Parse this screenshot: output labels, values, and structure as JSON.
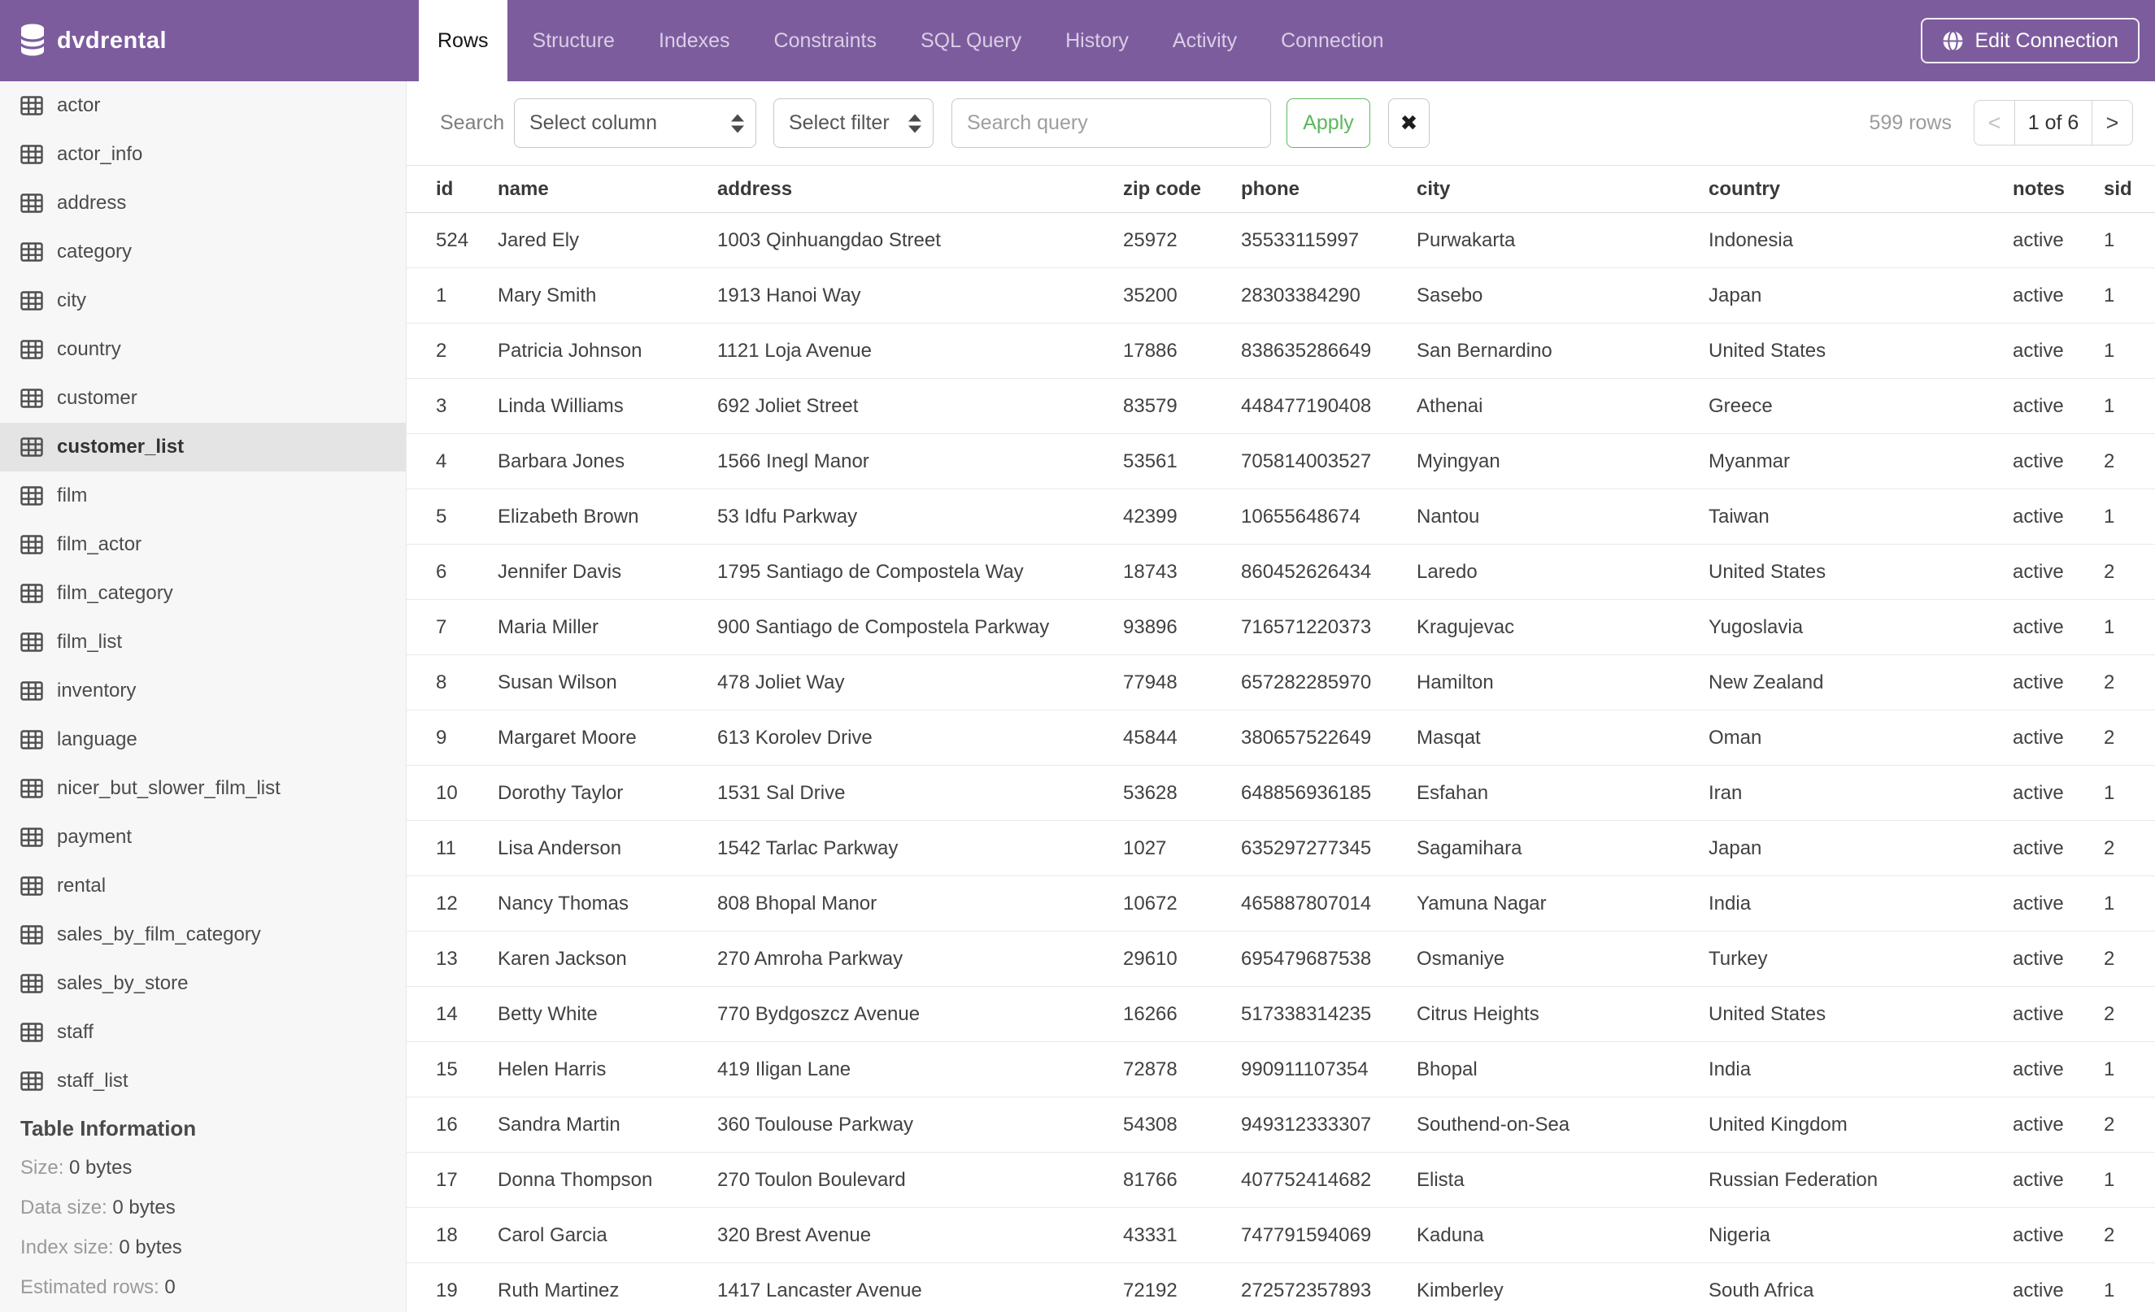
{
  "colors": {
    "purple": "#7D5C9E",
    "green": "#5CB85C",
    "sidebar_selected": "#E4E4E4"
  },
  "header": {
    "logo": "dvdrental",
    "tabs": [
      {
        "label": "Rows",
        "active": true
      },
      {
        "label": "Structure",
        "active": false
      },
      {
        "label": "Indexes",
        "active": false
      },
      {
        "label": "Constraints",
        "active": false
      },
      {
        "label": "SQL Query",
        "active": false
      },
      {
        "label": "History",
        "active": false
      },
      {
        "label": "Activity",
        "active": false
      },
      {
        "label": "Connection",
        "active": false
      }
    ],
    "edit_connection_label": "Edit Connection"
  },
  "sidebar": {
    "tables": [
      {
        "name": "actor",
        "selected": false
      },
      {
        "name": "actor_info",
        "selected": false
      },
      {
        "name": "address",
        "selected": false
      },
      {
        "name": "category",
        "selected": false
      },
      {
        "name": "city",
        "selected": false
      },
      {
        "name": "country",
        "selected": false
      },
      {
        "name": "customer",
        "selected": false
      },
      {
        "name": "customer_list",
        "selected": true
      },
      {
        "name": "film",
        "selected": false
      },
      {
        "name": "film_actor",
        "selected": false
      },
      {
        "name": "film_category",
        "selected": false
      },
      {
        "name": "film_list",
        "selected": false
      },
      {
        "name": "inventory",
        "selected": false
      },
      {
        "name": "language",
        "selected": false
      },
      {
        "name": "nicer_but_slower_film_list",
        "selected": false
      },
      {
        "name": "payment",
        "selected": false
      },
      {
        "name": "rental",
        "selected": false
      },
      {
        "name": "sales_by_film_category",
        "selected": false
      },
      {
        "name": "sales_by_store",
        "selected": false
      },
      {
        "name": "staff",
        "selected": false
      },
      {
        "name": "staff_list",
        "selected": false
      }
    ],
    "table_information": {
      "title": "Table Information",
      "rows": [
        {
          "label": "Size:",
          "value": "0 bytes"
        },
        {
          "label": "Data size:",
          "value": "0 bytes"
        },
        {
          "label": "Index size:",
          "value": "0 bytes"
        },
        {
          "label": "Estimated rows:",
          "value": "0"
        }
      ]
    }
  },
  "toolbar": {
    "search_label": "Search",
    "select_column_placeholder": "Select column",
    "select_filter_placeholder": "Select filter",
    "search_query_placeholder": "Search query",
    "apply_label": "Apply",
    "clear_label": "✖",
    "row_count": "599 rows",
    "pagination": {
      "prev": "<",
      "current": "1 of 6",
      "next": ">"
    }
  },
  "table": {
    "columns": [
      "id",
      "name",
      "address",
      "zip code",
      "phone",
      "city",
      "country",
      "notes",
      "sid"
    ],
    "rows": [
      [
        "524",
        "Jared Ely",
        "1003 Qinhuangdao Street",
        "25972",
        "35533115997",
        "Purwakarta",
        "Indonesia",
        "active",
        "1"
      ],
      [
        "1",
        "Mary Smith",
        "1913 Hanoi Way",
        "35200",
        "28303384290",
        "Sasebo",
        "Japan",
        "active",
        "1"
      ],
      [
        "2",
        "Patricia Johnson",
        "1121 Loja Avenue",
        "17886",
        "838635286649",
        "San Bernardino",
        "United States",
        "active",
        "1"
      ],
      [
        "3",
        "Linda Williams",
        "692 Joliet Street",
        "83579",
        "448477190408",
        "Athenai",
        "Greece",
        "active",
        "1"
      ],
      [
        "4",
        "Barbara Jones",
        "1566 Inegl Manor",
        "53561",
        "705814003527",
        "Myingyan",
        "Myanmar",
        "active",
        "2"
      ],
      [
        "5",
        "Elizabeth Brown",
        "53 Idfu Parkway",
        "42399",
        "10655648674",
        "Nantou",
        "Taiwan",
        "active",
        "1"
      ],
      [
        "6",
        "Jennifer Davis",
        "1795 Santiago de Compostela Way",
        "18743",
        "860452626434",
        "Laredo",
        "United States",
        "active",
        "2"
      ],
      [
        "7",
        "Maria Miller",
        "900 Santiago de Compostela Parkway",
        "93896",
        "716571220373",
        "Kragujevac",
        "Yugoslavia",
        "active",
        "1"
      ],
      [
        "8",
        "Susan Wilson",
        "478 Joliet Way",
        "77948",
        "657282285970",
        "Hamilton",
        "New Zealand",
        "active",
        "2"
      ],
      [
        "9",
        "Margaret Moore",
        "613 Korolev Drive",
        "45844",
        "380657522649",
        "Masqat",
        "Oman",
        "active",
        "2"
      ],
      [
        "10",
        "Dorothy Taylor",
        "1531 Sal Drive",
        "53628",
        "648856936185",
        "Esfahan",
        "Iran",
        "active",
        "1"
      ],
      [
        "11",
        "Lisa Anderson",
        "1542 Tarlac Parkway",
        "1027",
        "635297277345",
        "Sagamihara",
        "Japan",
        "active",
        "2"
      ],
      [
        "12",
        "Nancy Thomas",
        "808 Bhopal Manor",
        "10672",
        "465887807014",
        "Yamuna Nagar",
        "India",
        "active",
        "1"
      ],
      [
        "13",
        "Karen Jackson",
        "270 Amroha Parkway",
        "29610",
        "695479687538",
        "Osmaniye",
        "Turkey",
        "active",
        "2"
      ],
      [
        "14",
        "Betty White",
        "770 Bydgoszcz Avenue",
        "16266",
        "517338314235",
        "Citrus Heights",
        "United States",
        "active",
        "2"
      ],
      [
        "15",
        "Helen Harris",
        "419 Iligan Lane",
        "72878",
        "990911107354",
        "Bhopal",
        "India",
        "active",
        "1"
      ],
      [
        "16",
        "Sandra Martin",
        "360 Toulouse Parkway",
        "54308",
        "949312333307",
        "Southend-on-Sea",
        "United Kingdom",
        "active",
        "2"
      ],
      [
        "17",
        "Donna Thompson",
        "270 Toulon Boulevard",
        "81766",
        "407752414682",
        "Elista",
        "Russian Federation",
        "active",
        "1"
      ],
      [
        "18",
        "Carol Garcia",
        "320 Brest Avenue",
        "43331",
        "747791594069",
        "Kaduna",
        "Nigeria",
        "active",
        "2"
      ],
      [
        "19",
        "Ruth Martinez",
        "1417 Lancaster Avenue",
        "72192",
        "272572357893",
        "Kimberley",
        "South Africa",
        "active",
        "1"
      ]
    ]
  }
}
